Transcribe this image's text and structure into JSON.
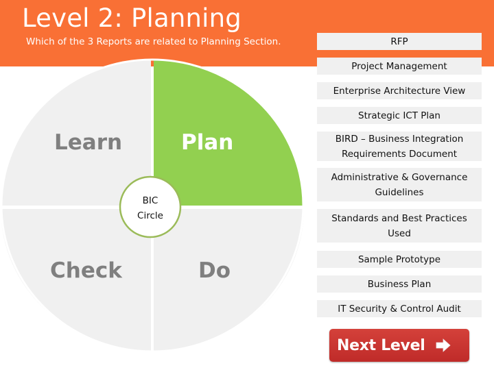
{
  "header": {
    "title": "Level 2: Planning",
    "subtitle": "Which of the 3 Reports are related to Planning Section."
  },
  "diagram": {
    "quadrants": [
      {
        "label": "Learn",
        "highlighted": false
      },
      {
        "label": "Plan",
        "highlighted": true
      },
      {
        "label": "Check",
        "highlighted": false
      },
      {
        "label": "Do",
        "highlighted": false
      }
    ],
    "center_label_line1": "BIC",
    "center_label_line2": "Circle",
    "colors": {
      "highlight": "#92d050",
      "default_fill": "#f0f0f0",
      "center_ring": "#9bbb59",
      "label_gray": "#7f7f7f"
    }
  },
  "options": [
    "RFP",
    "Project Management",
    "Enterprise Architecture View",
    "Strategic ICT Plan",
    "BIRD – Business Integration Requirements Document",
    "Administrative & Governance Guidelines",
    "Standards and Best Practices Used",
    "Sample Prototype",
    "Business Plan",
    "IT Security & Control Audit"
  ],
  "next_button": {
    "label": "Next Level",
    "icon": "arrow-right-icon"
  },
  "colors": {
    "header": "#f97035",
    "button": "#c8302e"
  }
}
